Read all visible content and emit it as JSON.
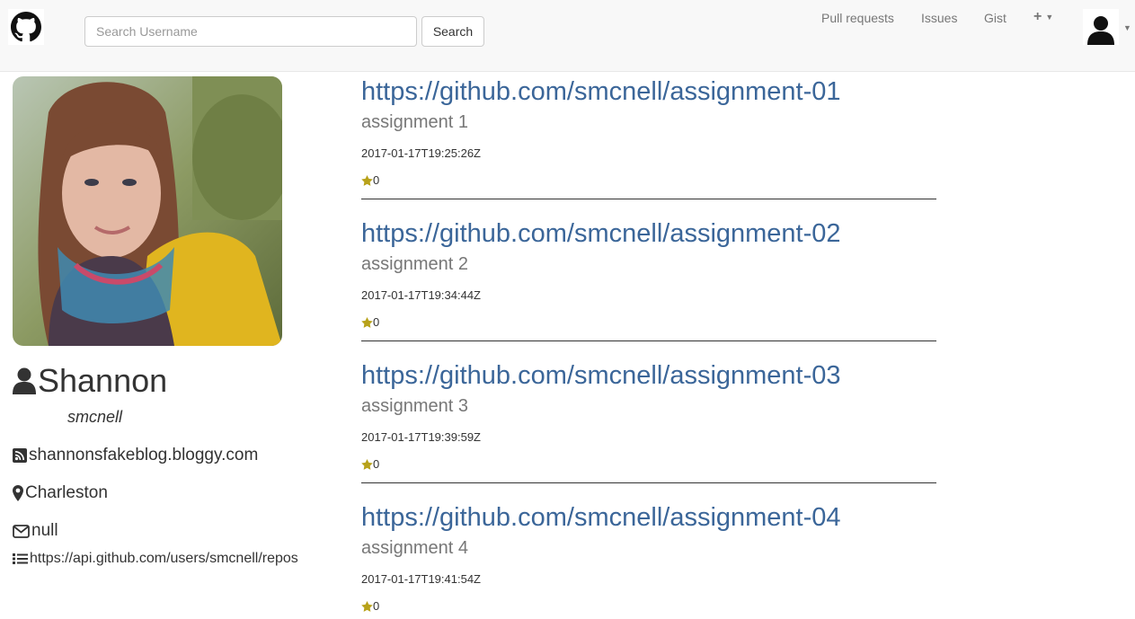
{
  "search": {
    "placeholder": "Search Username",
    "button_label": "Search"
  },
  "nav": {
    "pull_requests": "Pull requests",
    "issues": "Issues",
    "gist": "Gist",
    "plus": "+"
  },
  "profile": {
    "name": "Shannon",
    "login": "smcnell",
    "blog": "shannonsfakeblog.bloggy.com",
    "location": "Charleston",
    "email": "null",
    "repos_url": "https://api.github.com/users/smcnell/repos"
  },
  "repos": [
    {
      "url": "https://github.com/smcnell/assignment-01",
      "description": "assignment 1",
      "created": "2017-01-17T19:25:26Z",
      "stars": "0"
    },
    {
      "url": "https://github.com/smcnell/assignment-02",
      "description": "assignment 2",
      "created": "2017-01-17T19:34:44Z",
      "stars": "0"
    },
    {
      "url": "https://github.com/smcnell/assignment-03",
      "description": "assignment 3",
      "created": "2017-01-17T19:39:59Z",
      "stars": "0"
    },
    {
      "url": "https://github.com/smcnell/assignment-04",
      "description": "assignment 4",
      "created": "2017-01-17T19:41:54Z",
      "stars": "0"
    }
  ],
  "colors": {
    "link": "#3b6699",
    "star": "#b8a21a",
    "navbar_bg": "#f8f8f8"
  },
  "icons": {
    "logo": "github-octocat-icon",
    "user": "user-icon",
    "blog": "rss-icon",
    "location": "map-marker-icon",
    "email": "envelope-icon",
    "repos": "list-icon",
    "star": "star-icon"
  }
}
